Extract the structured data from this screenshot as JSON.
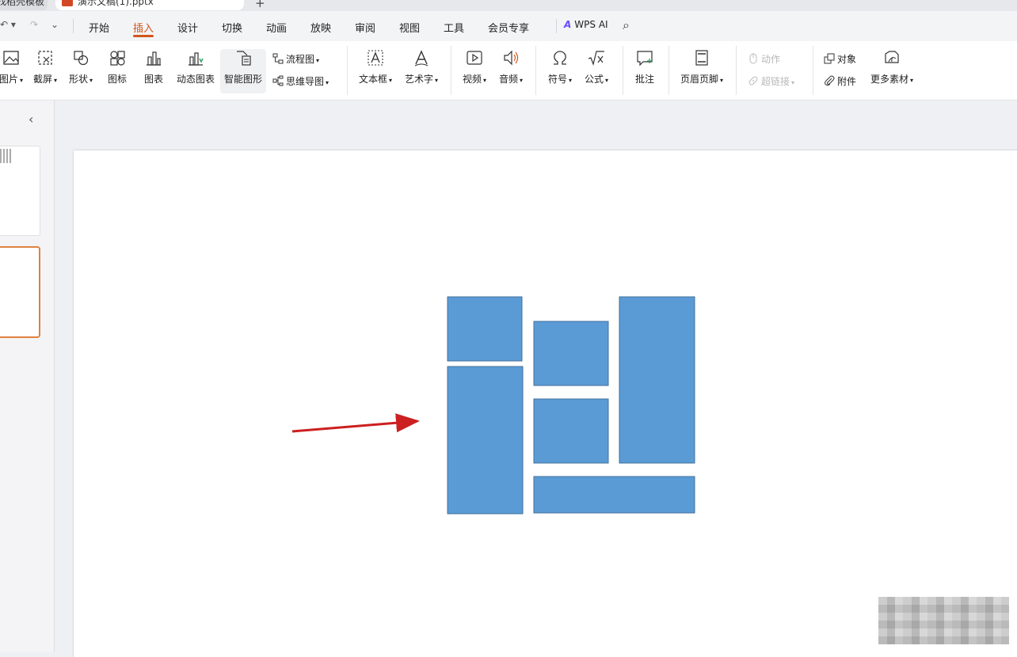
{
  "tabs": {
    "previous_tab": "找稻壳模板",
    "active_tab": "演示文稿(1).pptx",
    "add_tab": "+"
  },
  "menu": {
    "items": [
      "开始",
      "插入",
      "设计",
      "切换",
      "动画",
      "放映",
      "审阅",
      "视图",
      "工具",
      "会员专享"
    ],
    "active": "插入",
    "wps_ai": "WPS AI"
  },
  "ribbon": {
    "picture": "图片",
    "screenshot": "截屏",
    "shapes": "形状",
    "icons": "图标",
    "chart": "图表",
    "dynamic_chart": "动态图表",
    "smart_art": "智能图形",
    "flowchart": "流程图",
    "mindmap": "思维导图",
    "textbox": "文本框",
    "wordart": "艺术字",
    "video": "视频",
    "audio": "音频",
    "symbol": "符号",
    "formula": "公式",
    "comment": "批注",
    "header_footer": "页眉页脚",
    "action": "动作",
    "hyperlink": "超链接",
    "object": "对象",
    "attachment": "附件",
    "more_assets": "更多素材"
  },
  "colors": {
    "accent": "#d2561c",
    "shape_fill": "#5b9bd5",
    "shape_stroke": "#41719c",
    "arrow": "#cc1f1f",
    "selected_thumb_border": "#e0813f"
  }
}
